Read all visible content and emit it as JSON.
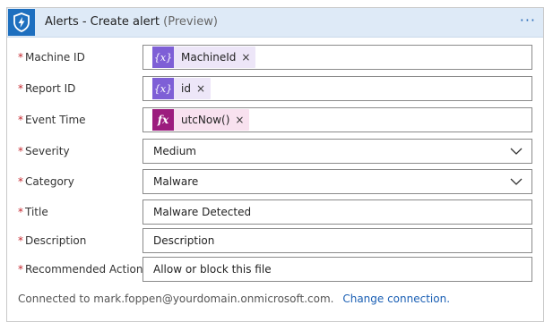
{
  "header": {
    "title": "Alerts - Create alert",
    "preview": "(Preview)",
    "more": "···",
    "app_icon": "shield-lightning-icon"
  },
  "fields": {
    "machine_id": {
      "label": "Machine ID",
      "token_label": "MachineId",
      "token_type": "variable"
    },
    "report_id": {
      "label": "Report ID",
      "token_label": "id",
      "token_type": "variable"
    },
    "event_time": {
      "label": "Event Time",
      "token_label": "utcNow()",
      "token_type": "expression"
    },
    "severity": {
      "label": "Severity",
      "value": "Medium"
    },
    "category": {
      "label": "Category",
      "value": "Malware"
    },
    "title": {
      "label": "Title",
      "value": "Malware Detected"
    },
    "description": {
      "label": "Description",
      "value": "Description"
    },
    "recommended_action": {
      "label": "Recommended Action",
      "value": "Allow or block this file"
    }
  },
  "required_marker": "*",
  "token_remove": "×",
  "token_icons": {
    "variable": "{x}",
    "expression": "fx"
  },
  "footer": {
    "connected_text": "Connected to mark.foppen@yourdomain.onmicrosoft.com.",
    "change_link": "Change connection."
  },
  "colors": {
    "header_bg": "#deeaf7",
    "app_icon_bg": "#1d6fbf",
    "variable_token": "#7e5fd6",
    "expression_token": "#9c1c7e",
    "required": "#c4262e",
    "link": "#1a5fb4"
  }
}
